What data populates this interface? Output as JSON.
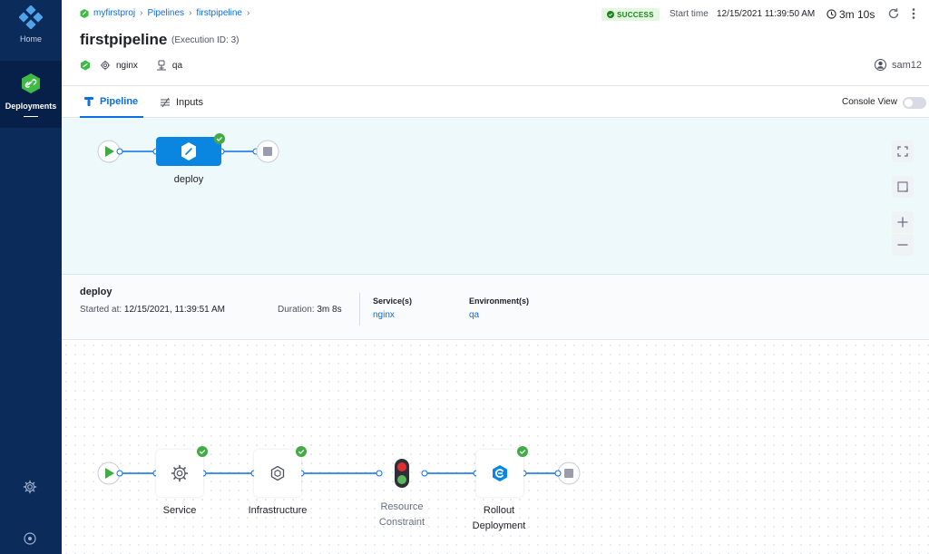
{
  "sidebar": {
    "home_label": "Home",
    "deployments_label": "Deployments"
  },
  "header": {
    "breadcrumbs": [
      "myfirstproj",
      "Pipelines",
      "firstpipeline"
    ],
    "title": "firstpipeline",
    "execution_id": "(Execution ID: 3)",
    "status": "SUCCESS",
    "start_time_label": "Start time",
    "start_time_value": "12/15/2021 11:39:50 AM",
    "duration": "3m 10s",
    "service_tag": "nginx",
    "environment_tag": "qa",
    "user": "sam12"
  },
  "tabs": {
    "pipeline": "Pipeline",
    "inputs": "Inputs",
    "console_view": "Console View"
  },
  "pipeline_graph": {
    "stage_label": "deploy"
  },
  "stage_details": {
    "name": "deploy",
    "started_label": "Started at:",
    "started_value": "12/15/2021, 11:39:51 AM",
    "duration_label": "Duration:",
    "duration_value": "3m 8s",
    "services_header": "Service(s)",
    "services_value": "nginx",
    "environments_header": "Environment(s)",
    "environments_value": "qa"
  },
  "stage_graph": {
    "steps": [
      {
        "label": "Service",
        "icon": "gear-icon",
        "status": "success"
      },
      {
        "label": "Infrastructure",
        "icon": "hexagon-icon",
        "status": "success"
      },
      {
        "label": "Resource Constraint",
        "icon": "traffic-light-icon",
        "status": "none"
      },
      {
        "label": "Rollout Deployment",
        "icon": "rollout-icon",
        "status": "success"
      }
    ],
    "step_labels": {
      "service": "Service",
      "infrastructure": "Infrastructure",
      "resource_line1": "Resource",
      "resource_line2": "Constraint",
      "rollout_line1": "Rollout",
      "rollout_line2": "Deployment"
    }
  },
  "colors": {
    "sidebar": "#0b2b5a",
    "accent": "#0b6ee4",
    "success": "#42ab45",
    "canvas_bg": "#eef9fc"
  }
}
